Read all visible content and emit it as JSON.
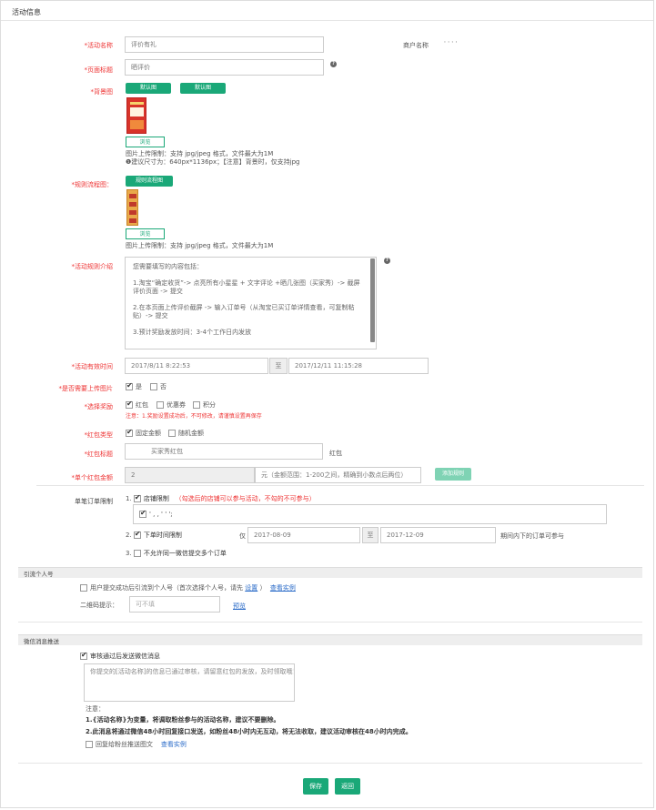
{
  "header": {
    "title": "活动信息"
  },
  "activity_name": {
    "label": "*活动名称",
    "value": "评价有礼"
  },
  "merchant": {
    "label": "商户名称",
    "value": "' ' ' '"
  },
  "page_title": {
    "label": "*页面标题",
    "value": "晒评价"
  },
  "background": {
    "label": "*背景图",
    "btn_default1": "默认图",
    "btn_default2": "默认图",
    "browse": "浏览",
    "hint1": "图片上传限制：支持 jpg/jpeg 格式，文件最大为1M",
    "hint2": "❶建议尺寸为：640px*1136px；【注意】背景时，仅支持jpg"
  },
  "rule_flow": {
    "label": "*规则流程图：",
    "btn_rule": "规则流程图",
    "browse": "浏览",
    "hint": "图片上传限制：支持 jpg/jpeg 格式，文件最大为1M"
  },
  "rule_intro": {
    "label": "*活动规则介绍",
    "lines": [
      "您需要填写的内容包括：",
      "1.淘宝“确定收货”-> 点亮所有小星星 + 文字评论 +晒几张图（买家秀）-> 截屏评价页面 -> 提交",
      "2.在本页面上传评价截屏 -> 输入订单号（从淘宝已买订单详情查看，可复制粘贴）-> 提交",
      "3.预计奖励发放时间：3-4个工作日内发放"
    ]
  },
  "valid_time": {
    "label": "*活动有效时间",
    "start": "2017/8/11 8:22:53",
    "sep": "至",
    "end": "2017/12/11 11:15:28"
  },
  "upload_image": {
    "label": "*是否需要上传图片",
    "yes": "是",
    "no": "否"
  },
  "reward": {
    "label": "*选择奖励",
    "options": [
      "红包",
      "优惠券",
      "积分"
    ],
    "note": "注意：1.奖励设置成功后，不可修改，请谨慎设置再保存"
  },
  "redpack_type": {
    "label": "*红包类型",
    "options": [
      "固定金额",
      "随机金额"
    ]
  },
  "redpack_title": {
    "label": "*红包标题",
    "value": "买家秀红包",
    "suffix": "红包"
  },
  "single_amount": {
    "label": "*单个红包金额",
    "value": "2",
    "unit_hint": "元（金额范围：1-200之间，精确到小数点后两位）",
    "add_rule": "添加规则"
  },
  "single_order_limit": {
    "label": "单笔订单限制",
    "item1_label": "店铺限制",
    "item1_hint": "（勾选后的店铺可以参与活动，不勾的不可参与）",
    "shop_name": "' ,  , ' ' ';",
    "item2_label": "下单时间限制",
    "item2_prefix": "仅",
    "order_start": "2017-08-09",
    "order_sep": "至",
    "order_end": "2017-12-09",
    "item2_suffix": "期间内下的订单可参与",
    "item3_label": "不允许同一微信提交多个订单",
    "n1": "1.",
    "n2": "2.",
    "n3": "3."
  },
  "guide_section": {
    "title": "引流个人号",
    "guide_check": "用户提交成功后引流到个人号（首次选择个人号，请先",
    "set_link": "设置",
    "guide_close": "）",
    "view_example": "查看实例",
    "qr_label": "二维码提示：",
    "qr_placeholder": "可不填",
    "preview": "预览"
  },
  "wechat_section": {
    "title": "微信消息推送",
    "push_check": "审核通过后发送微信消息",
    "message": "你提交的[活动名称]的信息已通过审核，请留意红包的发放，及时领取哦！",
    "note_title": "注意：",
    "note1": "1.{活动名称}为变量，将调取粉丝参与的活动名称，建议不要删除。",
    "note2": "2.此消息将通过微信48小时回复接口发送，如粉丝48小时内无互动，将无法收取，建议活动审核在48小时内完成。",
    "reply_check": "回复给粉丝推送图文",
    "view_example": "查看实例"
  },
  "footer": {
    "save": "保存",
    "back": "返回"
  },
  "colors": {
    "accent": "#1aa878",
    "danger": "#e33333",
    "link": "#2a6bc8"
  }
}
